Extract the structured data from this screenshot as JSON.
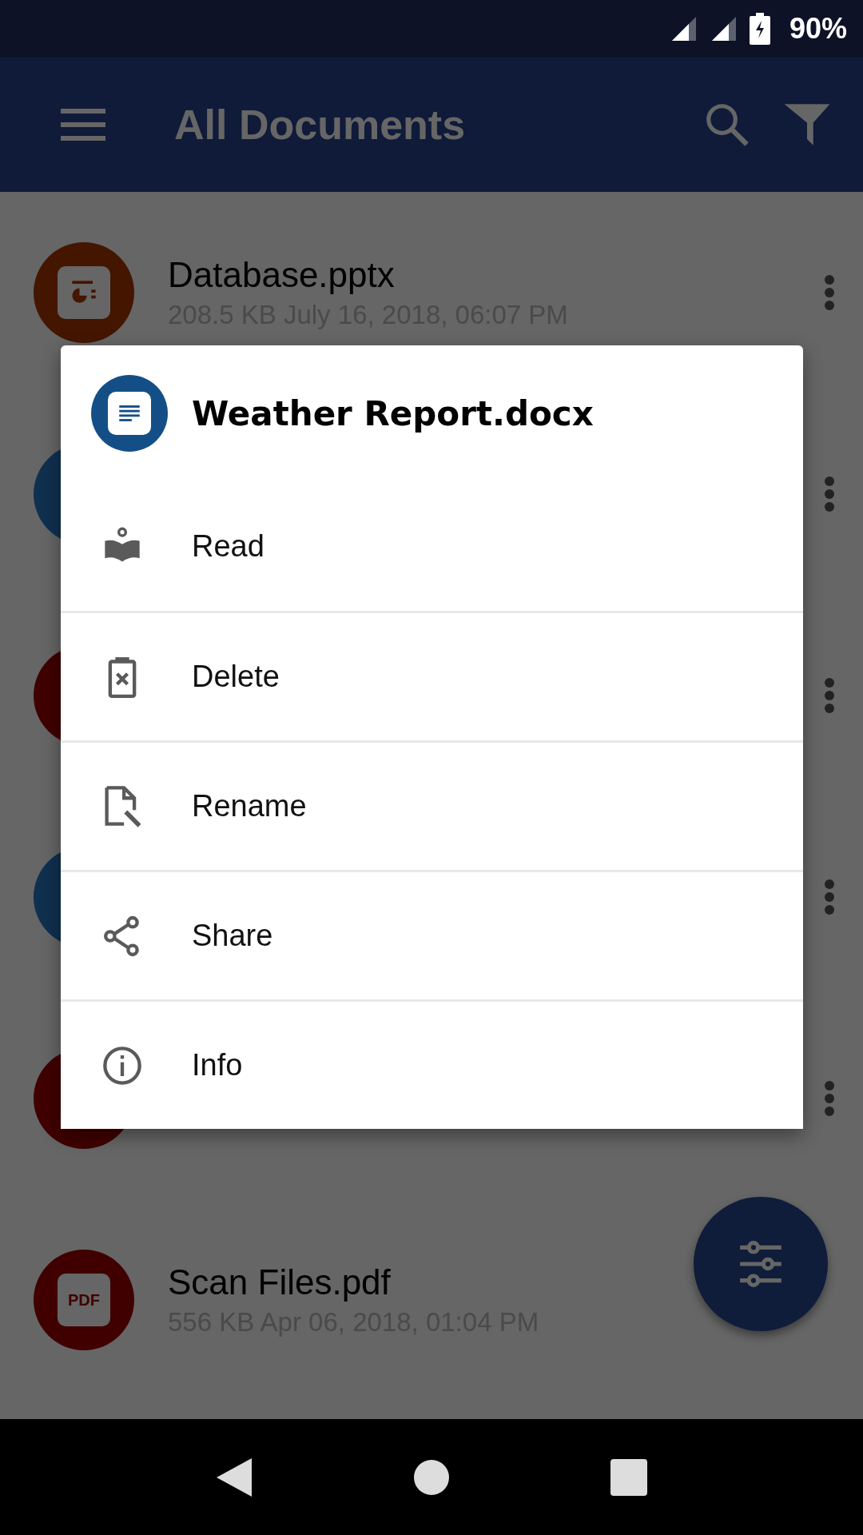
{
  "status_bar": {
    "battery": "90%"
  },
  "app_bar": {
    "title": "All Documents"
  },
  "documents": [
    {
      "name": "Database.pptx",
      "meta": "208.5 KB July 16, 2018, 06:07 PM",
      "kind": "slides",
      "color": "#441600"
    },
    {
      "color": "#10304f"
    },
    {
      "color": "#400000"
    },
    {
      "color": "#10304f"
    },
    {
      "color": "#400000"
    },
    {
      "name": "Scan Files.pdf",
      "meta": "556 KB Apr 06, 2018, 01:04 PM",
      "kind": "pdf",
      "badge": "PDF",
      "color": "#400000"
    }
  ],
  "dialog": {
    "title": "Weather Report.docx",
    "kind": "doc",
    "color": "#134f86",
    "actions": [
      {
        "label": "Read",
        "kind": "read"
      },
      {
        "label": "Delete",
        "kind": "delete"
      },
      {
        "label": "Rename",
        "kind": "rename"
      },
      {
        "label": "Share",
        "kind": "share"
      },
      {
        "label": "Info",
        "kind": "info"
      }
    ]
  }
}
